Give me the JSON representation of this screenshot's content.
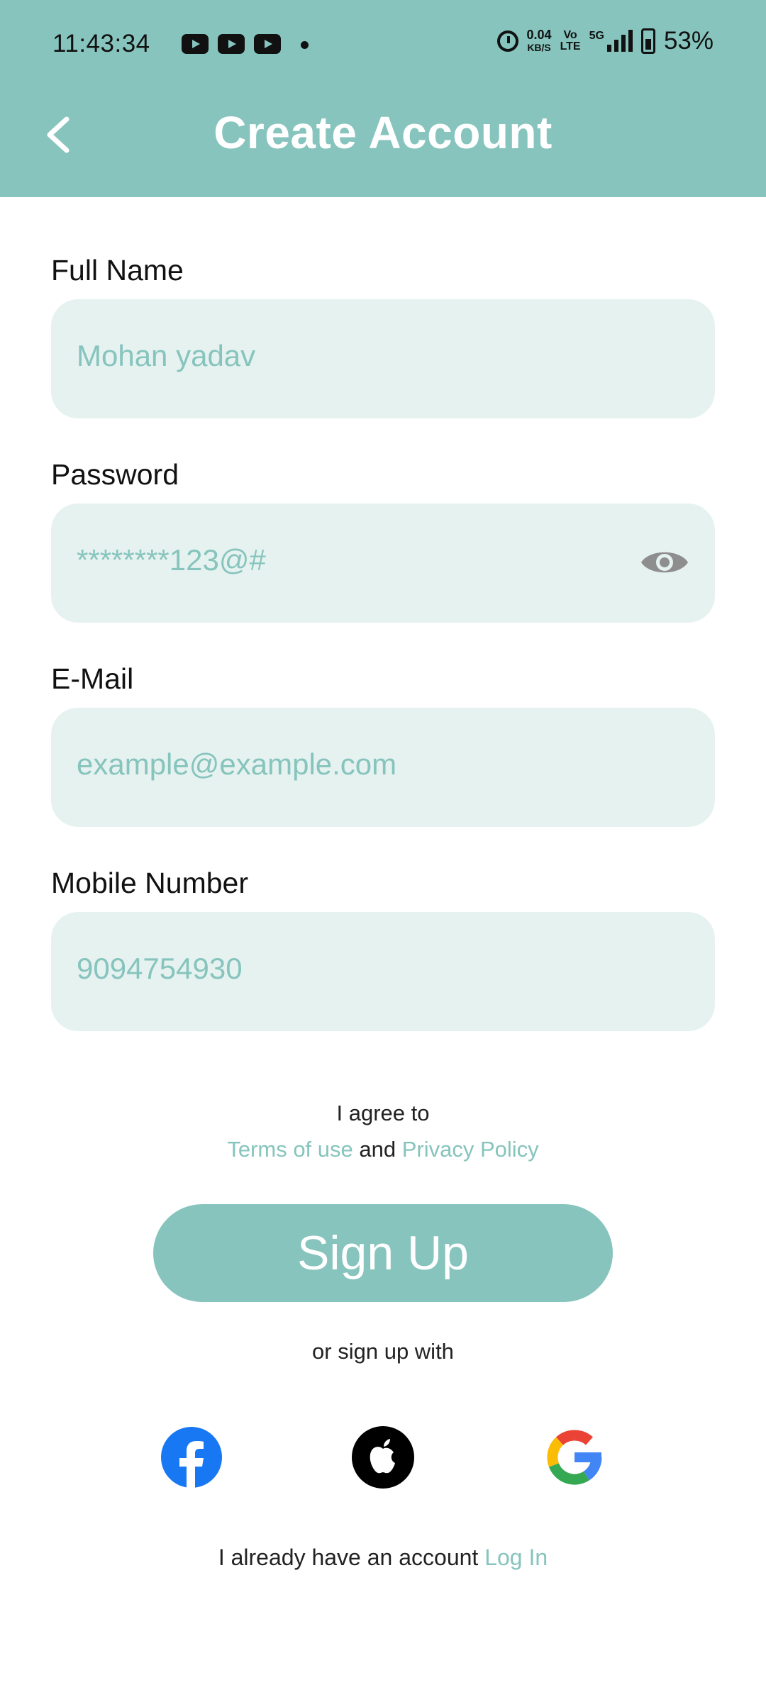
{
  "status_bar": {
    "time": "11:43:34",
    "net_speed_value": "0.04",
    "net_speed_unit": "KB/S",
    "volte_top": "Vo",
    "volte_bottom": "LTE",
    "network": "5G",
    "battery": "53%"
  },
  "header": {
    "title": "Create Account",
    "background": "#86C4BD"
  },
  "form": {
    "full_name": {
      "label": "Full Name",
      "value": "Mohan yadav"
    },
    "password": {
      "label": "Password",
      "value": "********123@#"
    },
    "email": {
      "label": "E-Mail",
      "value": "example@example.com"
    },
    "mobile": {
      "label": "Mobile Number",
      "value": "9094754930"
    }
  },
  "agreement": {
    "line1": "I agree to",
    "terms": "Terms of use",
    "and": "and",
    "privacy": "Privacy Policy"
  },
  "signup_button": {
    "label": "Sign Up"
  },
  "alt_signup": {
    "label": "or sign up with",
    "providers": [
      "facebook-icon",
      "apple-icon",
      "google-icon"
    ]
  },
  "footer": {
    "text": "I already have an account",
    "login_link": "Log In"
  },
  "colors": {
    "accent": "#86C4BD",
    "field_bg": "#E6F2F0",
    "facebook": "#1877F2"
  }
}
